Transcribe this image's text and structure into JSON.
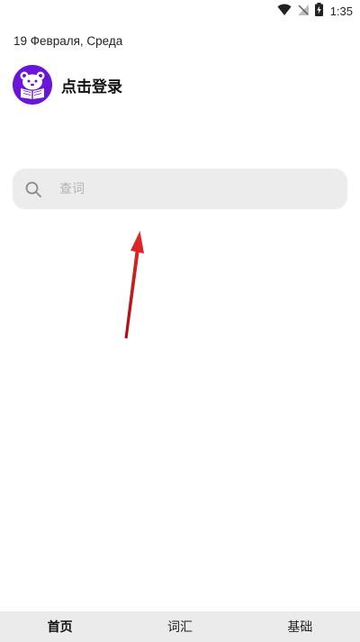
{
  "status_bar": {
    "time": "1:35",
    "icons": [
      "wifi-icon",
      "signal-off-icon",
      "battery-charging-icon"
    ]
  },
  "header": {
    "date": "19 Февраля, Среда"
  },
  "profile": {
    "login_label": "点击登录",
    "avatar_icon": "reading-bear-icon",
    "avatar_color": "#6a16d6"
  },
  "search": {
    "placeholder": "查词",
    "value": "",
    "icon": "search-icon"
  },
  "annotation": {
    "arrow_color": "#d42020"
  },
  "bottom_nav": {
    "tabs": [
      {
        "label": "首页",
        "active": true
      },
      {
        "label": "词汇",
        "active": false
      },
      {
        "label": "基础",
        "active": false
      }
    ]
  }
}
